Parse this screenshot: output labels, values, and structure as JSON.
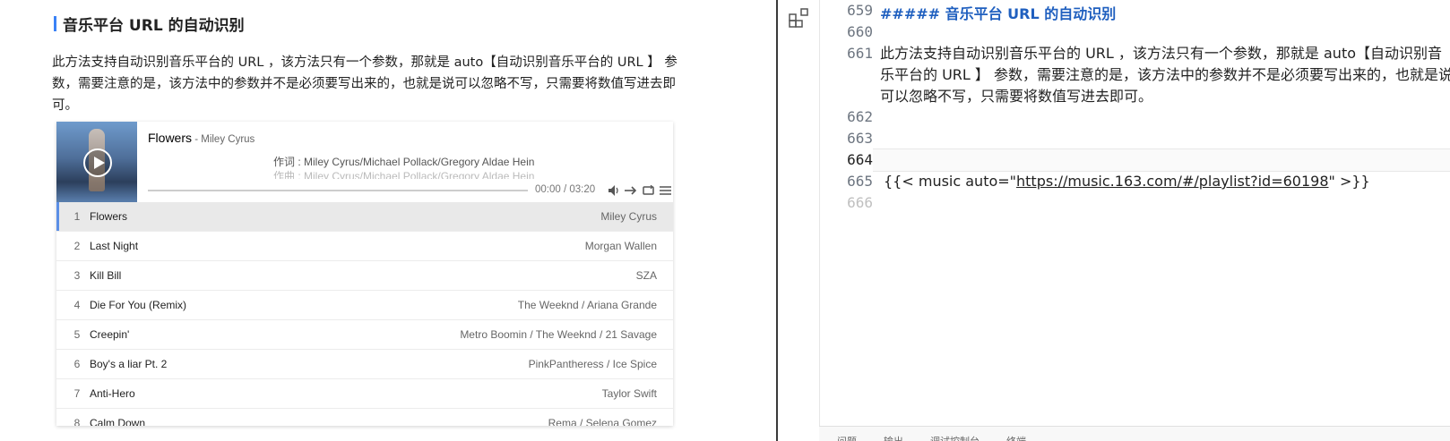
{
  "preview": {
    "heading": "音乐平台 URL 的自动识别",
    "paragraph": "此方法支持自动识别音乐平台的 URL ，该方法只有一个参数，那就是 auto【自动识别音乐平台的 URL 】 参数，需要注意的是，该方法中的参数并不是必须要写出来的，也就是说可以忽略不写，只需要将数值写进去即可。",
    "player": {
      "title": "Flowers",
      "artist": " - Miley Cyrus",
      "lyric_line1": "作词 : Miley Cyrus/Michael Pollack/Gregory Aldae Hein",
      "lyric_line2": "作曲 : Miley Cyrus/Michael Pollack/Gregory Aldae Hein",
      "time": "00:00 / 03:20",
      "progress": 0,
      "tracks": [
        {
          "num": "1",
          "name": "Flowers",
          "artist": "Miley Cyrus"
        },
        {
          "num": "2",
          "name": "Last Night",
          "artist": "Morgan Wallen"
        },
        {
          "num": "3",
          "name": "Kill Bill",
          "artist": "SZA"
        },
        {
          "num": "4",
          "name": "Die For You (Remix)",
          "artist": "The Weeknd / Ariana Grande"
        },
        {
          "num": "5",
          "name": "Creepin'",
          "artist": "Metro Boomin / The Weeknd / 21 Savage"
        },
        {
          "num": "6",
          "name": "Boy's a liar Pt. 2",
          "artist": "PinkPantheress / Ice Spice"
        },
        {
          "num": "7",
          "name": "Anti-Hero",
          "artist": "Taylor Swift"
        },
        {
          "num": "8",
          "name": "Calm Down",
          "artist": "Rema / Selena Gomez"
        }
      ]
    }
  },
  "editor": {
    "line_numbers": [
      "659",
      "660",
      "661",
      "662",
      "663",
      "664",
      "665",
      "666"
    ],
    "current_line": "664",
    "heading_line": "##### 音乐平台 URL 的自动识别",
    "body_line": "此方法支持自动识别音乐平台的 URL ，该方法只有一个参数，那就是 auto【自动识别音乐平台的 URL 】 参数，需要注意的是，该方法中的参数并不是必须要写出来的，也就是说可以忽略不写，只需要将数值写进去即可。",
    "shortcode_prefix": "{{< music auto=\"",
    "shortcode_url": "https://music.163.com/#/playlist?id=60198",
    "shortcode_suffix": "\" >}}",
    "panel_tabs": [
      "问题",
      "输出",
      "调试控制台",
      "终端"
    ]
  },
  "colors": {
    "accent_blue": "#3b82f6",
    "heading_code": "#1f5fbf",
    "active_row": "#e9e9e9"
  }
}
